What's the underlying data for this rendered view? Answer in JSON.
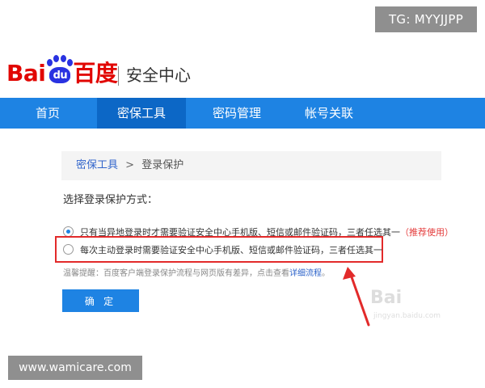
{
  "watermarks": {
    "top_right": "TG: MYYJJPP",
    "bottom_left": "www.wamicare.com",
    "faint_brand": "Bai",
    "faint_brand_sub": "jingyan.baidu.com"
  },
  "header": {
    "logo_bai": "Bai",
    "logo_du": "du",
    "logo_cn": "百度",
    "section_title": "安全中心"
  },
  "nav": {
    "tabs": [
      {
        "label": "首页",
        "active": false
      },
      {
        "label": "密保工具",
        "active": true
      },
      {
        "label": "密码管理",
        "active": false
      },
      {
        "label": "帐号关联",
        "active": false
      }
    ]
  },
  "breadcrumb": {
    "parent": "密保工具",
    "separator": ">",
    "current": "登录保护"
  },
  "main": {
    "heading": "选择登录保护方式：",
    "options": [
      {
        "text": "只有当异地登录时才需要验证安全中心手机版、短信或邮件验证码，三者任选其一",
        "recommend_open": "（",
        "recommend": "推荐使用",
        "recommend_close": "）",
        "checked": true
      },
      {
        "text": "每次主动登录时需要验证安全中心手机版、短信或邮件验证码，三者任选其一",
        "checked": false
      }
    ],
    "tip_prefix": "温馨提醒：百度客户端登录保护流程与网页版有差异，点击查看",
    "tip_link": "详细流程",
    "tip_suffix": "。",
    "confirm_button": "确 定"
  },
  "colors": {
    "brand_blue": "#1e83e3",
    "nav_active": "#0c67c6",
    "brand_red": "#e10602",
    "highlight_red": "#e22a2a",
    "link_blue": "#3366cc"
  }
}
